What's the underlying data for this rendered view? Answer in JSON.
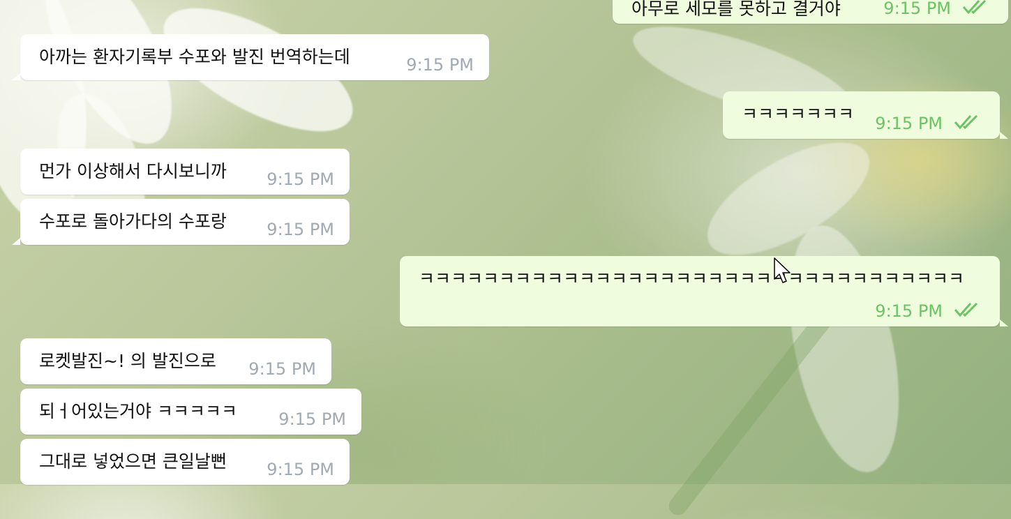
{
  "chat": {
    "messages": [
      {
        "dir": "out",
        "text": "아무로 세모를 못하고 결거야",
        "time": "9:15 PM"
      },
      {
        "dir": "in",
        "text": "아까는 환자기록부 수포와 발진 번역하는데",
        "time": "9:15 PM"
      },
      {
        "dir": "out",
        "text": "ㅋㅋㅋㅋㅋㅋㅋ",
        "time": "9:15 PM"
      },
      {
        "dir": "in",
        "text": "먼가 이상해서 다시보니까",
        "time": "9:15 PM"
      },
      {
        "dir": "in",
        "text": "수포로 돌아가다의 수포랑",
        "time": "9:15 PM"
      },
      {
        "dir": "out",
        "text": "ㅋㅋㅋㅋㅋㅋㅋㅋㅋㅋㅋㅋㅋㅋㅋㅋㅋㅋㅋㅋㅋㅋㅋㅋㅋㅋㅋㅋㅋㅋㅋㅋㅋㅋ",
        "time": "9:15 PM"
      },
      {
        "dir": "in",
        "text": "로켓발진~! 의 발진으로",
        "time": "9:15 PM"
      },
      {
        "dir": "in",
        "text": "되ㅓ어있는거야 ㅋㅋㅋㅋㅋ",
        "time": "9:15 PM"
      },
      {
        "dir": "in",
        "text": "그대로 넣었으면 큰일날뻔",
        "time": "9:15 PM"
      }
    ]
  },
  "icons": {
    "read_receipt": "double-check-icon",
    "cursor": "mouse-pointer-icon"
  },
  "colors": {
    "incoming_bubble": "#ffffff",
    "outgoing_bubble": "#effdde",
    "outgoing_time": "#6cc264",
    "incoming_time": "#a1aab3"
  }
}
